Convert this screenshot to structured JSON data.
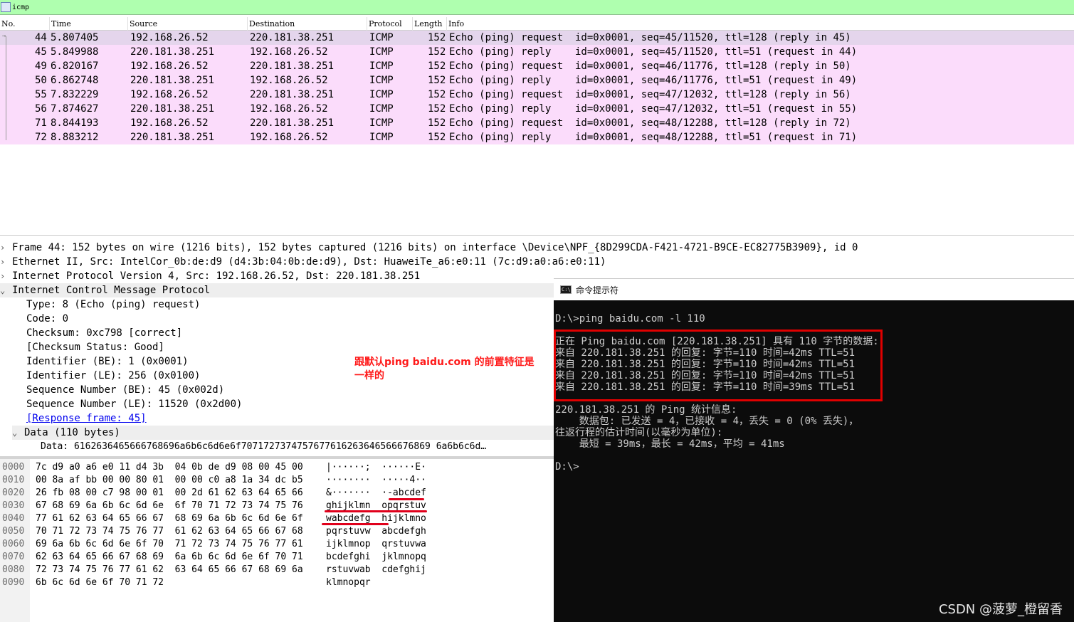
{
  "filter": {
    "value": "icmp"
  },
  "packet_list": {
    "columns": [
      "No.",
      "Time",
      "Source",
      "Destination",
      "Protocol",
      "Length",
      "Info"
    ],
    "rows": [
      {
        "no": "44",
        "time": "5.807405",
        "src": "192.168.26.52",
        "dst": "220.181.38.251",
        "proto": "ICMP",
        "len": "152",
        "info": "Echo (ping) request  id=0x0001, seq=45/11520, ttl=128 (reply in 45)"
      },
      {
        "no": "45",
        "time": "5.849988",
        "src": "220.181.38.251",
        "dst": "192.168.26.52",
        "proto": "ICMP",
        "len": "152",
        "info": "Echo (ping) reply    id=0x0001, seq=45/11520, ttl=51 (request in 44)"
      },
      {
        "no": "49",
        "time": "6.820167",
        "src": "192.168.26.52",
        "dst": "220.181.38.251",
        "proto": "ICMP",
        "len": "152",
        "info": "Echo (ping) request  id=0x0001, seq=46/11776, ttl=128 (reply in 50)"
      },
      {
        "no": "50",
        "time": "6.862748",
        "src": "220.181.38.251",
        "dst": "192.168.26.52",
        "proto": "ICMP",
        "len": "152",
        "info": "Echo (ping) reply    id=0x0001, seq=46/11776, ttl=51 (request in 49)"
      },
      {
        "no": "55",
        "time": "7.832229",
        "src": "192.168.26.52",
        "dst": "220.181.38.251",
        "proto": "ICMP",
        "len": "152",
        "info": "Echo (ping) request  id=0x0001, seq=47/12032, ttl=128 (reply in 56)"
      },
      {
        "no": "56",
        "time": "7.874627",
        "src": "220.181.38.251",
        "dst": "192.168.26.52",
        "proto": "ICMP",
        "len": "152",
        "info": "Echo (ping) reply    id=0x0001, seq=47/12032, ttl=51 (request in 55)"
      },
      {
        "no": "71",
        "time": "8.844193",
        "src": "192.168.26.52",
        "dst": "220.181.38.251",
        "proto": "ICMP",
        "len": "152",
        "info": "Echo (ping) request  id=0x0001, seq=48/12288, ttl=128 (reply in 72)"
      },
      {
        "no": "72",
        "time": "8.883212",
        "src": "220.181.38.251",
        "dst": "192.168.26.52",
        "proto": "ICMP",
        "len": "152",
        "info": "Echo (ping) reply    id=0x0001, seq=48/12288, ttl=51 (request in 71)"
      }
    ]
  },
  "details": {
    "frame": "Frame 44: 152 bytes on wire (1216 bits), 152 bytes captured (1216 bits) on interface \\Device\\NPF_{8D299CDA-F421-4721-B9CE-EC82775B3909}, id 0",
    "ethernet": "Ethernet II, Src: IntelCor_0b:de:d9 (d4:3b:04:0b:de:d9), Dst: HuaweiTe_a6:e0:11 (7c:d9:a0:a6:e0:11)",
    "ip": "Internet Protocol Version 4, Src: 192.168.26.52, Dst: 220.181.38.251",
    "icmp": "Internet Control Message Protocol",
    "fields": [
      "Type: 8 (Echo (ping) request)",
      "Code: 0",
      "Checksum: 0xc798 [correct]",
      "[Checksum Status: Good]",
      "Identifier (BE): 1 (0x0001)",
      "Identifier (LE): 256 (0x0100)",
      "Sequence Number (BE): 45 (0x002d)",
      "Sequence Number (LE): 11520 (0x2d00)"
    ],
    "response_link": "[Response frame: 45]",
    "data": "Data (110 bytes)",
    "data_value": "Data: 6162636465666768696a6b6c6d6e6f7071727374757677616263646566676869 6a6b6c6d…"
  },
  "annotation": "跟默认ping baidu.com 的前置特征是一样的",
  "bytes": [
    {
      "off": "0000",
      "hex": "7c d9 a0 a6 e0 11 d4 3b  04 0b de d9 08 00 45 00",
      "ascii": "|······;  ······E·"
    },
    {
      "off": "0010",
      "hex": "00 8a af bb 00 00 80 01  00 00 c0 a8 1a 34 dc b5",
      "ascii": "········  ·····4··"
    },
    {
      "off": "0020",
      "hex": "26 fb 08 00 c7 98 00 01  00 2d 61 62 63 64 65 66",
      "ascii": "&·······  ·-abcdef"
    },
    {
      "off": "0030",
      "hex": "67 68 69 6a 6b 6c 6d 6e  6f 70 71 72 73 74 75 76",
      "ascii": "ghijklmn  opqrstuv"
    },
    {
      "off": "0040",
      "hex": "77 61 62 63 64 65 66 67  68 69 6a 6b 6c 6d 6e 6f",
      "ascii": "wabcdefg  hijklmno"
    },
    {
      "off": "0050",
      "hex": "70 71 72 73 74 75 76 77  61 62 63 64 65 66 67 68",
      "ascii": "pqrstuvw  abcdefgh"
    },
    {
      "off": "0060",
      "hex": "69 6a 6b 6c 6d 6e 6f 70  71 72 73 74 75 76 77 61",
      "ascii": "ijklmnop  qrstuvwa"
    },
    {
      "off": "0070",
      "hex": "62 63 64 65 66 67 68 69  6a 6b 6c 6d 6e 6f 70 71",
      "ascii": "bcdefghi  jklmnopq"
    },
    {
      "off": "0080",
      "hex": "72 73 74 75 76 77 61 62  63 64 65 66 67 68 69 6a",
      "ascii": "rstuvwab  cdefghij"
    },
    {
      "off": "0090",
      "hex": "6b 6c 6d 6e 6f 70 71 72",
      "ascii": "klmnopqr"
    }
  ],
  "cmd": {
    "title": "命令提示符",
    "lines": [
      "D:\\>ping baidu.com -l 110",
      "",
      "正在 Ping baidu.com [220.181.38.251] 具有 110 字节的数据:",
      "来自 220.181.38.251 的回复: 字节=110 时间=42ms TTL=51",
      "来自 220.181.38.251 的回复: 字节=110 时间=42ms TTL=51",
      "来自 220.181.38.251 的回复: 字节=110 时间=42ms TTL=51",
      "来自 220.181.38.251 的回复: 字节=110 时间=39ms TTL=51",
      "",
      "220.181.38.251 的 Ping 统计信息:",
      "    数据包: 已发送 = 4，已接收 = 4，丢失 = 0 (0% 丢失)，",
      "往返行程的估计时间(以毫秒为单位):",
      "    最短 = 39ms，最长 = 42ms，平均 = 41ms",
      "",
      "D:\\>"
    ]
  },
  "watermark": "CSDN @菠萝_橙留香"
}
